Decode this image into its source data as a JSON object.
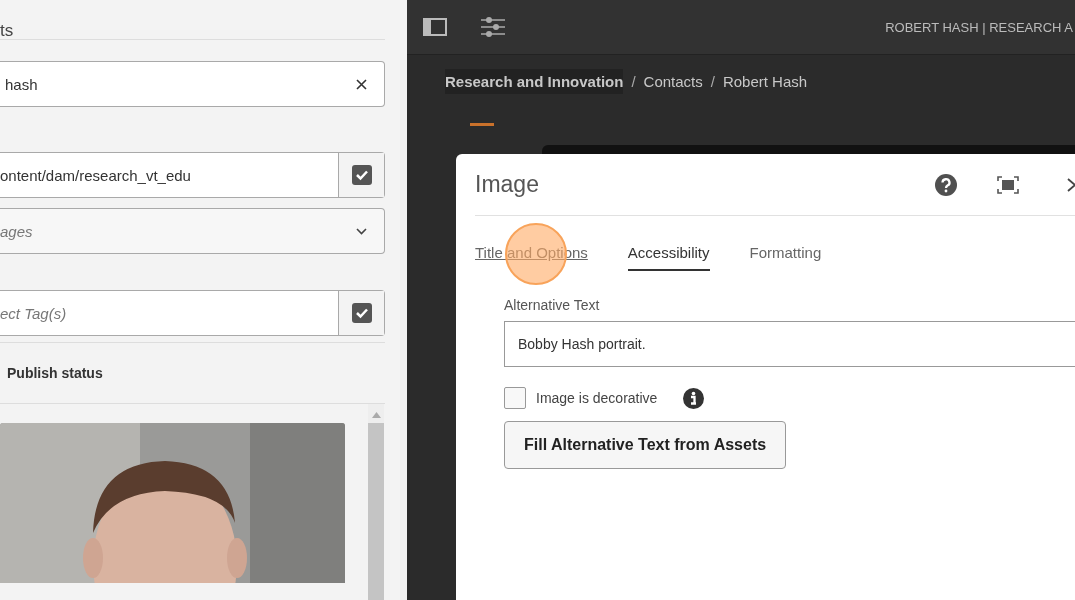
{
  "side_panel": {
    "heading": "ts",
    "search": {
      "value": "hash"
    },
    "path_field": {
      "value": "ontent/dam/research_vt_edu"
    },
    "type_dropdown": {
      "placeholder": "ages"
    },
    "tags_field": {
      "placeholder": "ect Tag(s)"
    },
    "publish_status": "Publish status"
  },
  "top_bar": {
    "page_title": "ROBERT HASH | RESEARCH A"
  },
  "breadcrumb": [
    {
      "label": "Research and Innovation",
      "highlighted": true
    },
    {
      "separator": "/",
      "label": "Contacts",
      "highlighted": false
    },
    {
      "separator": "/",
      "label": "Robert Hash",
      "highlighted": false
    }
  ],
  "dialog": {
    "title": "Image",
    "tabs": [
      {
        "label": "Title and Options",
        "selected": false,
        "hovered": true
      },
      {
        "label": "Accessibility",
        "selected": true,
        "hovered": false
      },
      {
        "label": "Formatting",
        "selected": false,
        "hovered": false
      }
    ],
    "alt_text": {
      "label": "Alternative Text",
      "value": "Bobby Hash portrait."
    },
    "decorative": {
      "label": "Image is decorative",
      "checked": false
    },
    "fill_button": "Fill Alternative Text from Assets"
  },
  "click_marker": {
    "shown": true
  }
}
